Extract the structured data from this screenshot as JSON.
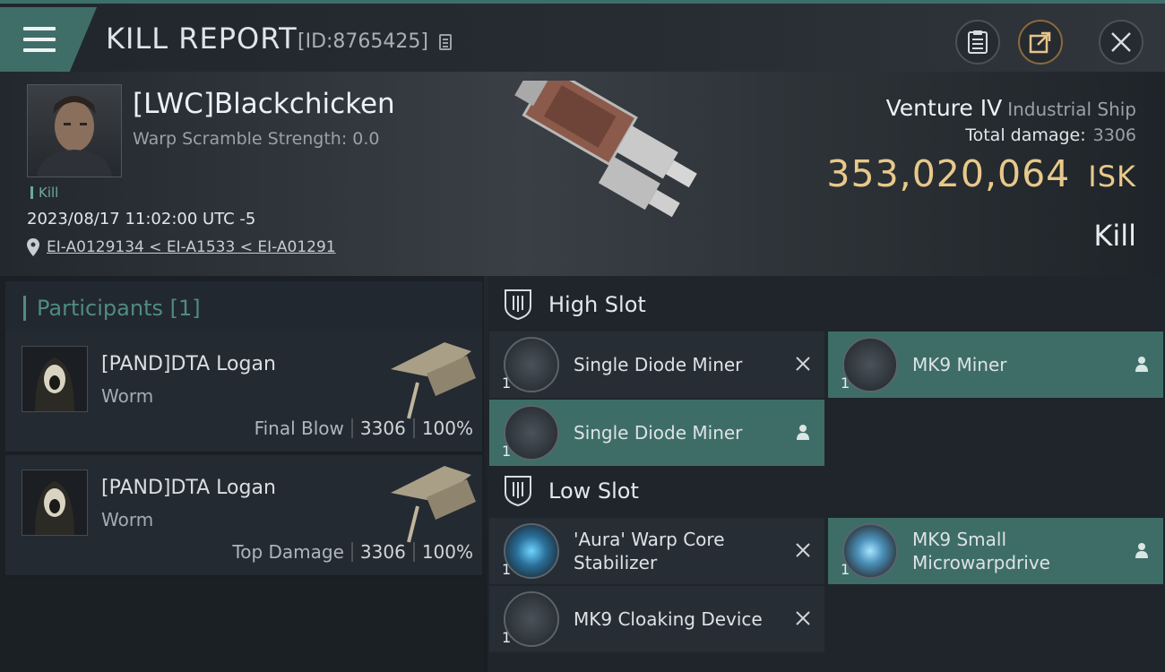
{
  "header": {
    "title": "KILL REPORT",
    "id": "[ID:8765425]"
  },
  "summary": {
    "pilot_name": "[LWC]Blackchicken",
    "warp_scramble": "Warp Scramble Strength: 0.0",
    "tag": "Kill",
    "date": "2023/08/17 11:02:00 UTC -5",
    "location": "EI-A0129134 < EI-A1533 < EI-A01291",
    "ship_name": "Venture IV",
    "ship_class": "Industrial Ship",
    "total_damage_label": "Total damage:",
    "total_damage_value": "3306",
    "isk_value": "353,020,064",
    "isk_unit": "ISK",
    "result_label": "Kill"
  },
  "participants": {
    "title": "Participants [1]",
    "items": [
      {
        "name": "[PAND]DTA Logan",
        "corp": "Worm",
        "role": "Final Blow",
        "damage": "3306",
        "percent": "100%"
      },
      {
        "name": "[PAND]DTA Logan",
        "corp": "Worm",
        "role": "Top Damage",
        "damage": "3306",
        "percent": "100%"
      }
    ]
  },
  "slots": {
    "high": {
      "title": "High Slot",
      "modules": [
        {
          "name": "Single Diode Miner",
          "qty": "1"
        },
        {
          "name": "MK9 Miner",
          "qty": "1"
        },
        {
          "name": "Single Diode Miner",
          "qty": "1"
        }
      ]
    },
    "low": {
      "title": "Low Slot",
      "modules": [
        {
          "name": "'Aura' Warp Core Stabilizer",
          "qty": "1"
        },
        {
          "name": "MK9 Small Microwarpdrive",
          "qty": "1"
        },
        {
          "name": "MK9 Cloaking Device",
          "qty": "1"
        }
      ]
    }
  },
  "colors": {
    "accent": "#3f6e69",
    "isk": "#e8c98a"
  },
  "icons": [
    "menu-icon",
    "copy-icon",
    "clipboard-icon",
    "share-icon",
    "close-icon",
    "location-pin-icon",
    "shield-slot-icon",
    "destroyed-x-icon",
    "pilot-icon"
  ]
}
